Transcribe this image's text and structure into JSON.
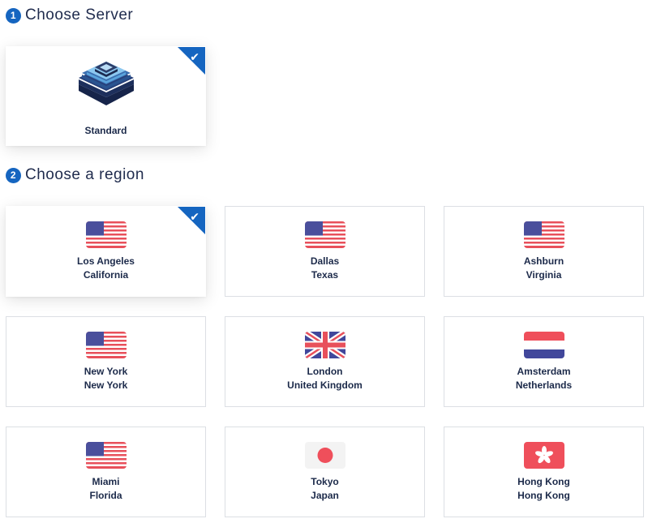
{
  "server_section": {
    "step": "1",
    "title": "Choose Server"
  },
  "servers": [
    {
      "label": "Standard",
      "icon": "server-chip-icon",
      "selected": true
    }
  ],
  "region_section": {
    "step": "2",
    "title": "Choose a region"
  },
  "regions": [
    {
      "city": "Los Angeles",
      "area": "California",
      "flag": "us-flag-icon",
      "selected": true
    },
    {
      "city": "Dallas",
      "area": "Texas",
      "flag": "us-flag-icon",
      "selected": false
    },
    {
      "city": "Ashburn",
      "area": "Virginia",
      "flag": "us-flag-icon",
      "selected": false
    },
    {
      "city": "New York",
      "area": "New York",
      "flag": "us-flag-icon",
      "selected": false
    },
    {
      "city": "London",
      "area": "United Kingdom",
      "flag": "uk-flag-icon",
      "selected": false
    },
    {
      "city": "Amsterdam",
      "area": "Netherlands",
      "flag": "nl-flag-icon",
      "selected": false
    },
    {
      "city": "Miami",
      "area": "Florida",
      "flag": "us-flag-icon",
      "selected": false
    },
    {
      "city": "Tokyo",
      "area": "Japan",
      "flag": "jp-flag-icon",
      "selected": false
    },
    {
      "city": "Hong Kong",
      "area": "Hong Kong",
      "flag": "hk-flag-icon",
      "selected": false
    }
  ],
  "colors": {
    "accent": "#1565c0",
    "text": "#1c2a4a",
    "border": "#dcdfe4"
  }
}
